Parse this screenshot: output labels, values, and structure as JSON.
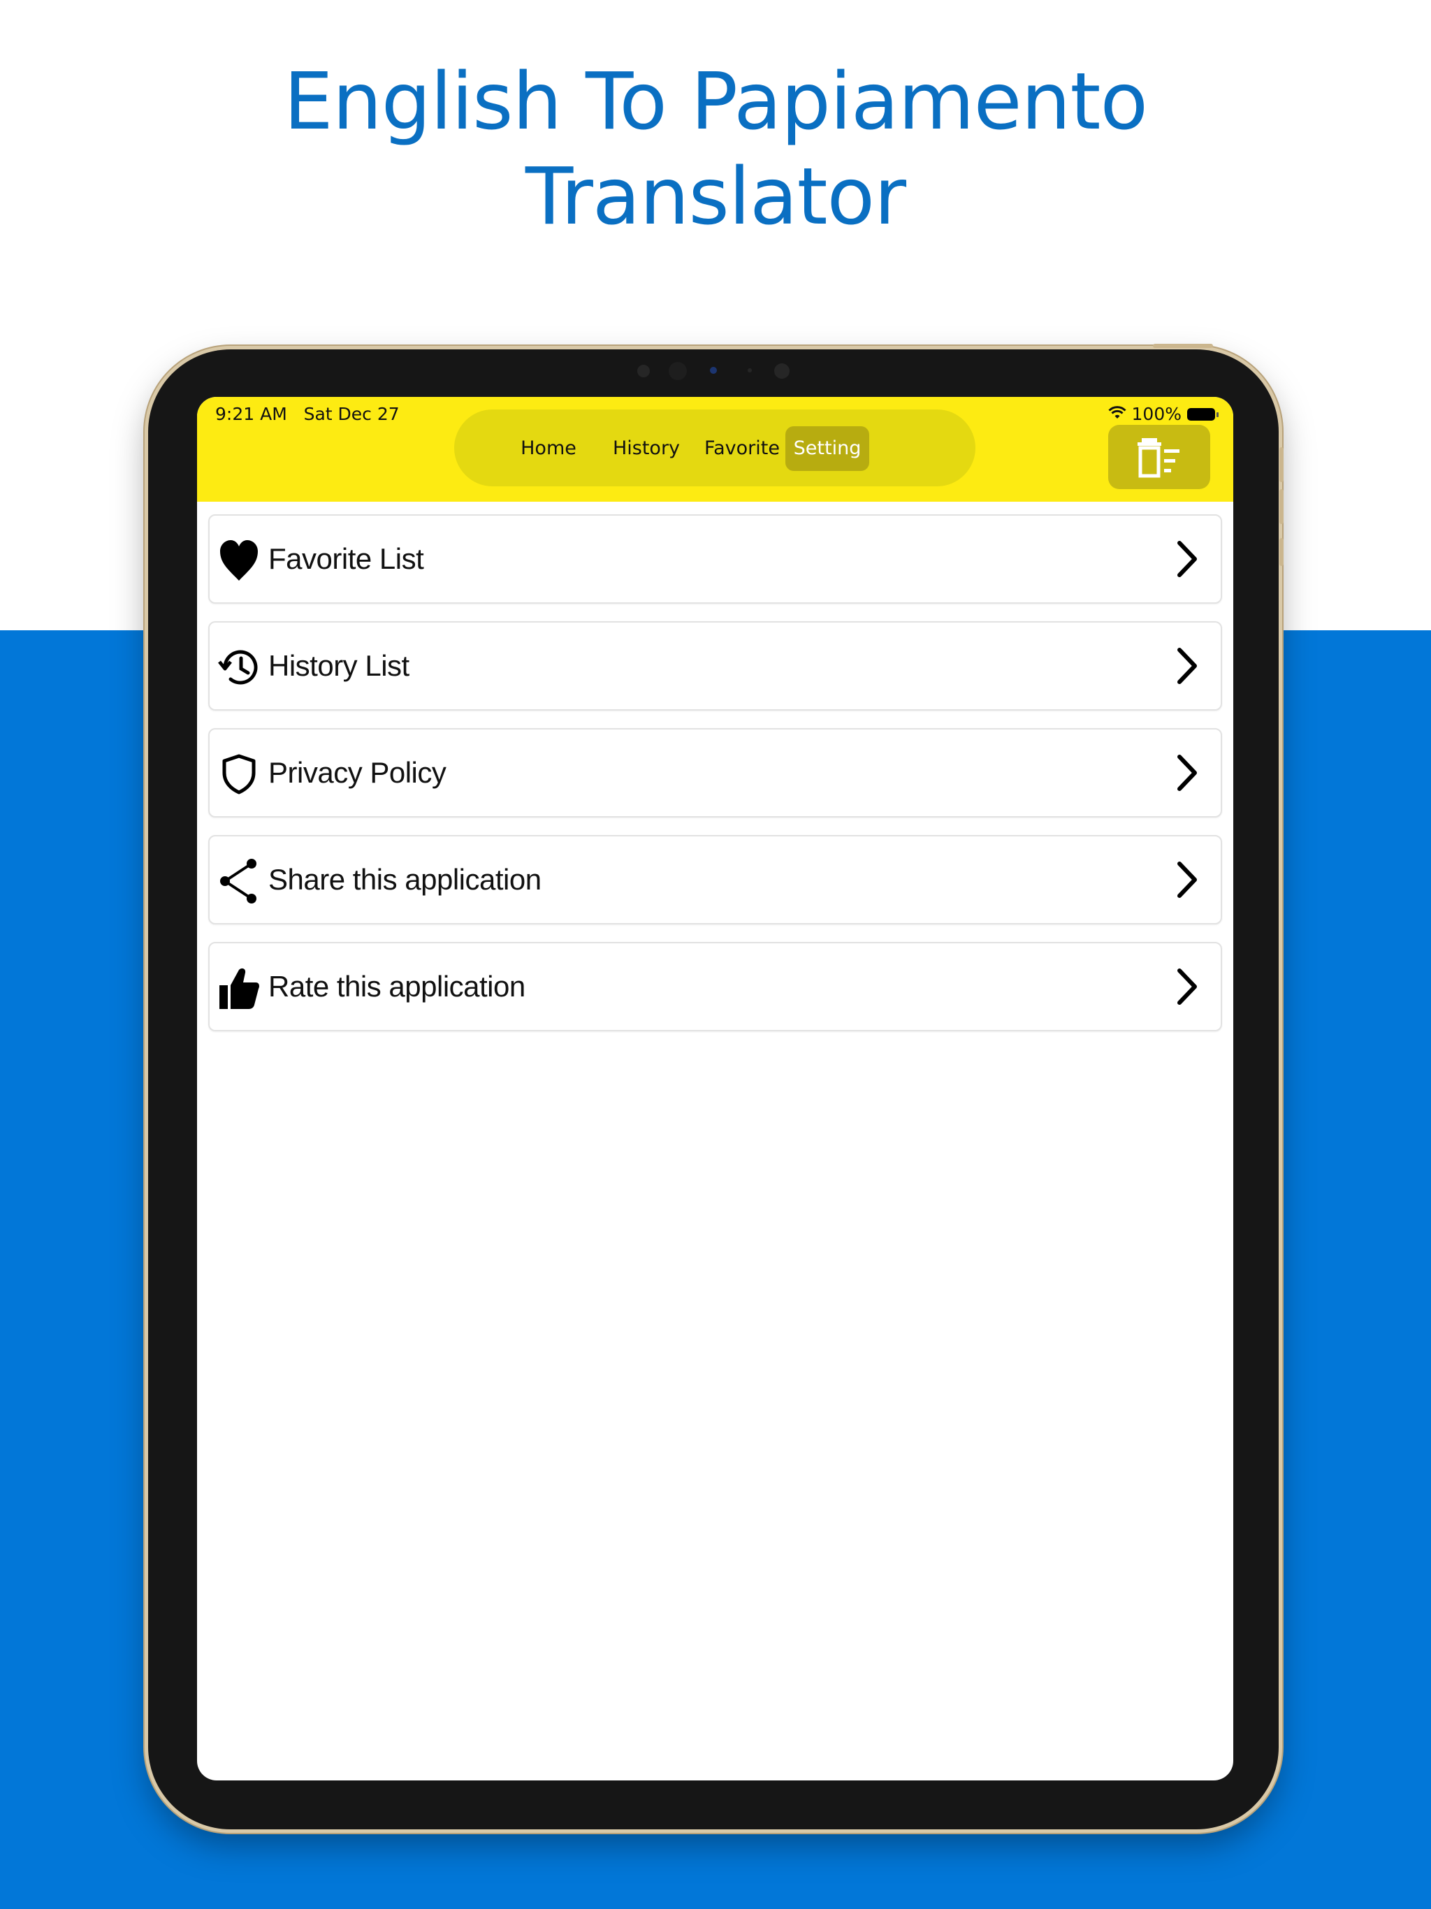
{
  "headline": {
    "line1": "English To Papiamento",
    "line2": "Translator"
  },
  "status_bar": {
    "time": "9:21 AM   Sat Dec 27",
    "battery": "100%"
  },
  "tabs": [
    {
      "label": "Home",
      "active": false
    },
    {
      "label": "History",
      "active": false
    },
    {
      "label": "Favorite",
      "active": false
    },
    {
      "label": "Setting",
      "active": true
    }
  ],
  "toolbar": {
    "trash_icon": "trash-list-icon"
  },
  "settings_list": [
    {
      "label": "Favorite List",
      "icon": "heart-icon"
    },
    {
      "label": "History List",
      "icon": "history-icon"
    },
    {
      "label": "Privacy Policy",
      "icon": "shield-icon"
    },
    {
      "label": "Share this application",
      "icon": "share-icon"
    },
    {
      "label": "Rate this application",
      "icon": "thumbs-up-icon"
    }
  ],
  "colors": {
    "brand_blue": "#0277d8",
    "headline_blue": "#0a6fc2",
    "topbar_yellow": "#fdeb12",
    "active_tab": "#b7ac10"
  }
}
